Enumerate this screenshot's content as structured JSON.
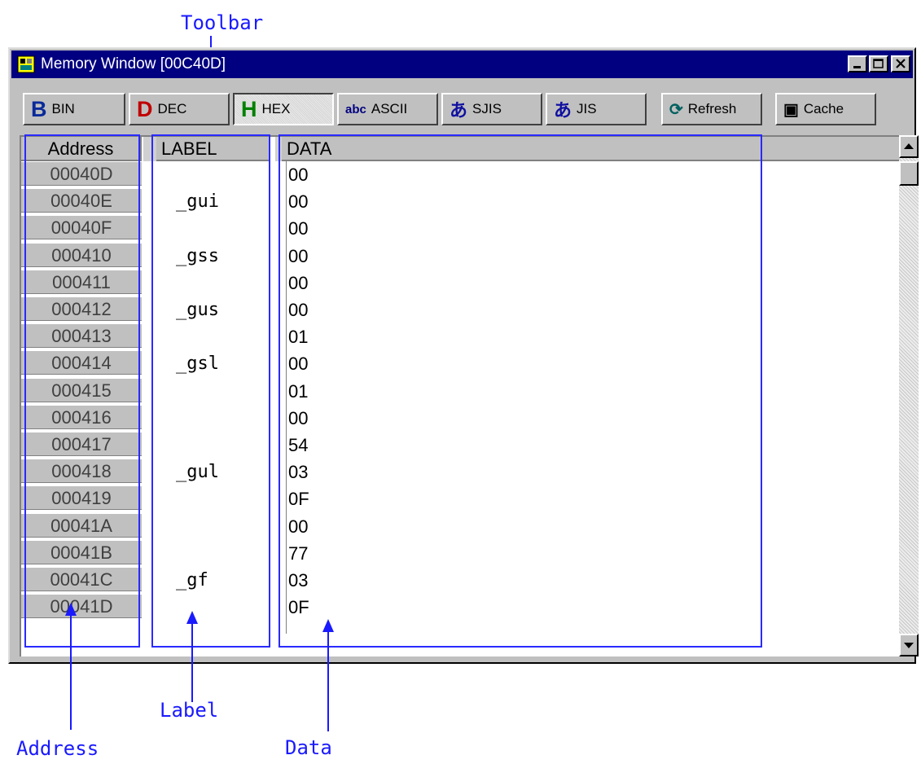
{
  "window": {
    "title": "Memory Window [00C40D]",
    "icon": "memory-window-icon"
  },
  "toolbar": [
    {
      "id": "bin",
      "icon_char": "B",
      "icon_color": "#0a2a9a",
      "label": "BIN"
    },
    {
      "id": "dec",
      "icon_char": "D",
      "icon_color": "#c00000",
      "label": "DEC"
    },
    {
      "id": "hex",
      "icon_char": "H",
      "icon_color": "#008000",
      "label": "HEX",
      "pressed": true
    },
    {
      "id": "ascii",
      "icon_char": "abc",
      "icon_color": "#000080",
      "label": "ASCII"
    },
    {
      "id": "sjis",
      "icon_char": "あ",
      "icon_color": "#1010a0",
      "label": "SJIS"
    },
    {
      "id": "jis",
      "icon_char": "あ",
      "icon_color": "#1010a0",
      "label": "JIS"
    },
    {
      "id": "refresh",
      "icon_char": "⟳",
      "icon_color": "#006060",
      "label": "Refresh"
    },
    {
      "id": "cache",
      "icon_char": "▣",
      "icon_color": "#000000",
      "label": "Cache"
    }
  ],
  "columns": {
    "address": "Address",
    "label": "LABEL",
    "data": "DATA"
  },
  "rows": [
    {
      "address": "00040D",
      "label": "",
      "data": "00"
    },
    {
      "address": "00040E",
      "label": "_gui",
      "data": "00"
    },
    {
      "address": "00040F",
      "label": "",
      "data": "00"
    },
    {
      "address": "000410",
      "label": "_gss",
      "data": "00"
    },
    {
      "address": "000411",
      "label": "",
      "data": "00"
    },
    {
      "address": "000412",
      "label": "_gus",
      "data": "00"
    },
    {
      "address": "000413",
      "label": "",
      "data": "01"
    },
    {
      "address": "000414",
      "label": "_gsl",
      "data": "00"
    },
    {
      "address": "000415",
      "label": "",
      "data": "01"
    },
    {
      "address": "000416",
      "label": "",
      "data": "00"
    },
    {
      "address": "000417",
      "label": "",
      "data": "54"
    },
    {
      "address": "000418",
      "label": "_gul",
      "data": "03"
    },
    {
      "address": "000419",
      "label": "",
      "data": "0F"
    },
    {
      "address": "00041A",
      "label": "",
      "data": "00"
    },
    {
      "address": "00041B",
      "label": "",
      "data": "77"
    },
    {
      "address": "00041C",
      "label": "_gf",
      "data": "03"
    },
    {
      "address": "00041D",
      "label": "",
      "data": "0F"
    }
  ],
  "callouts": {
    "toolbar": "Toolbar",
    "address": "Address",
    "label": "Label",
    "data": "Data"
  },
  "colors": {
    "titlebar": "#000080",
    "callout": "#1a1aff"
  }
}
